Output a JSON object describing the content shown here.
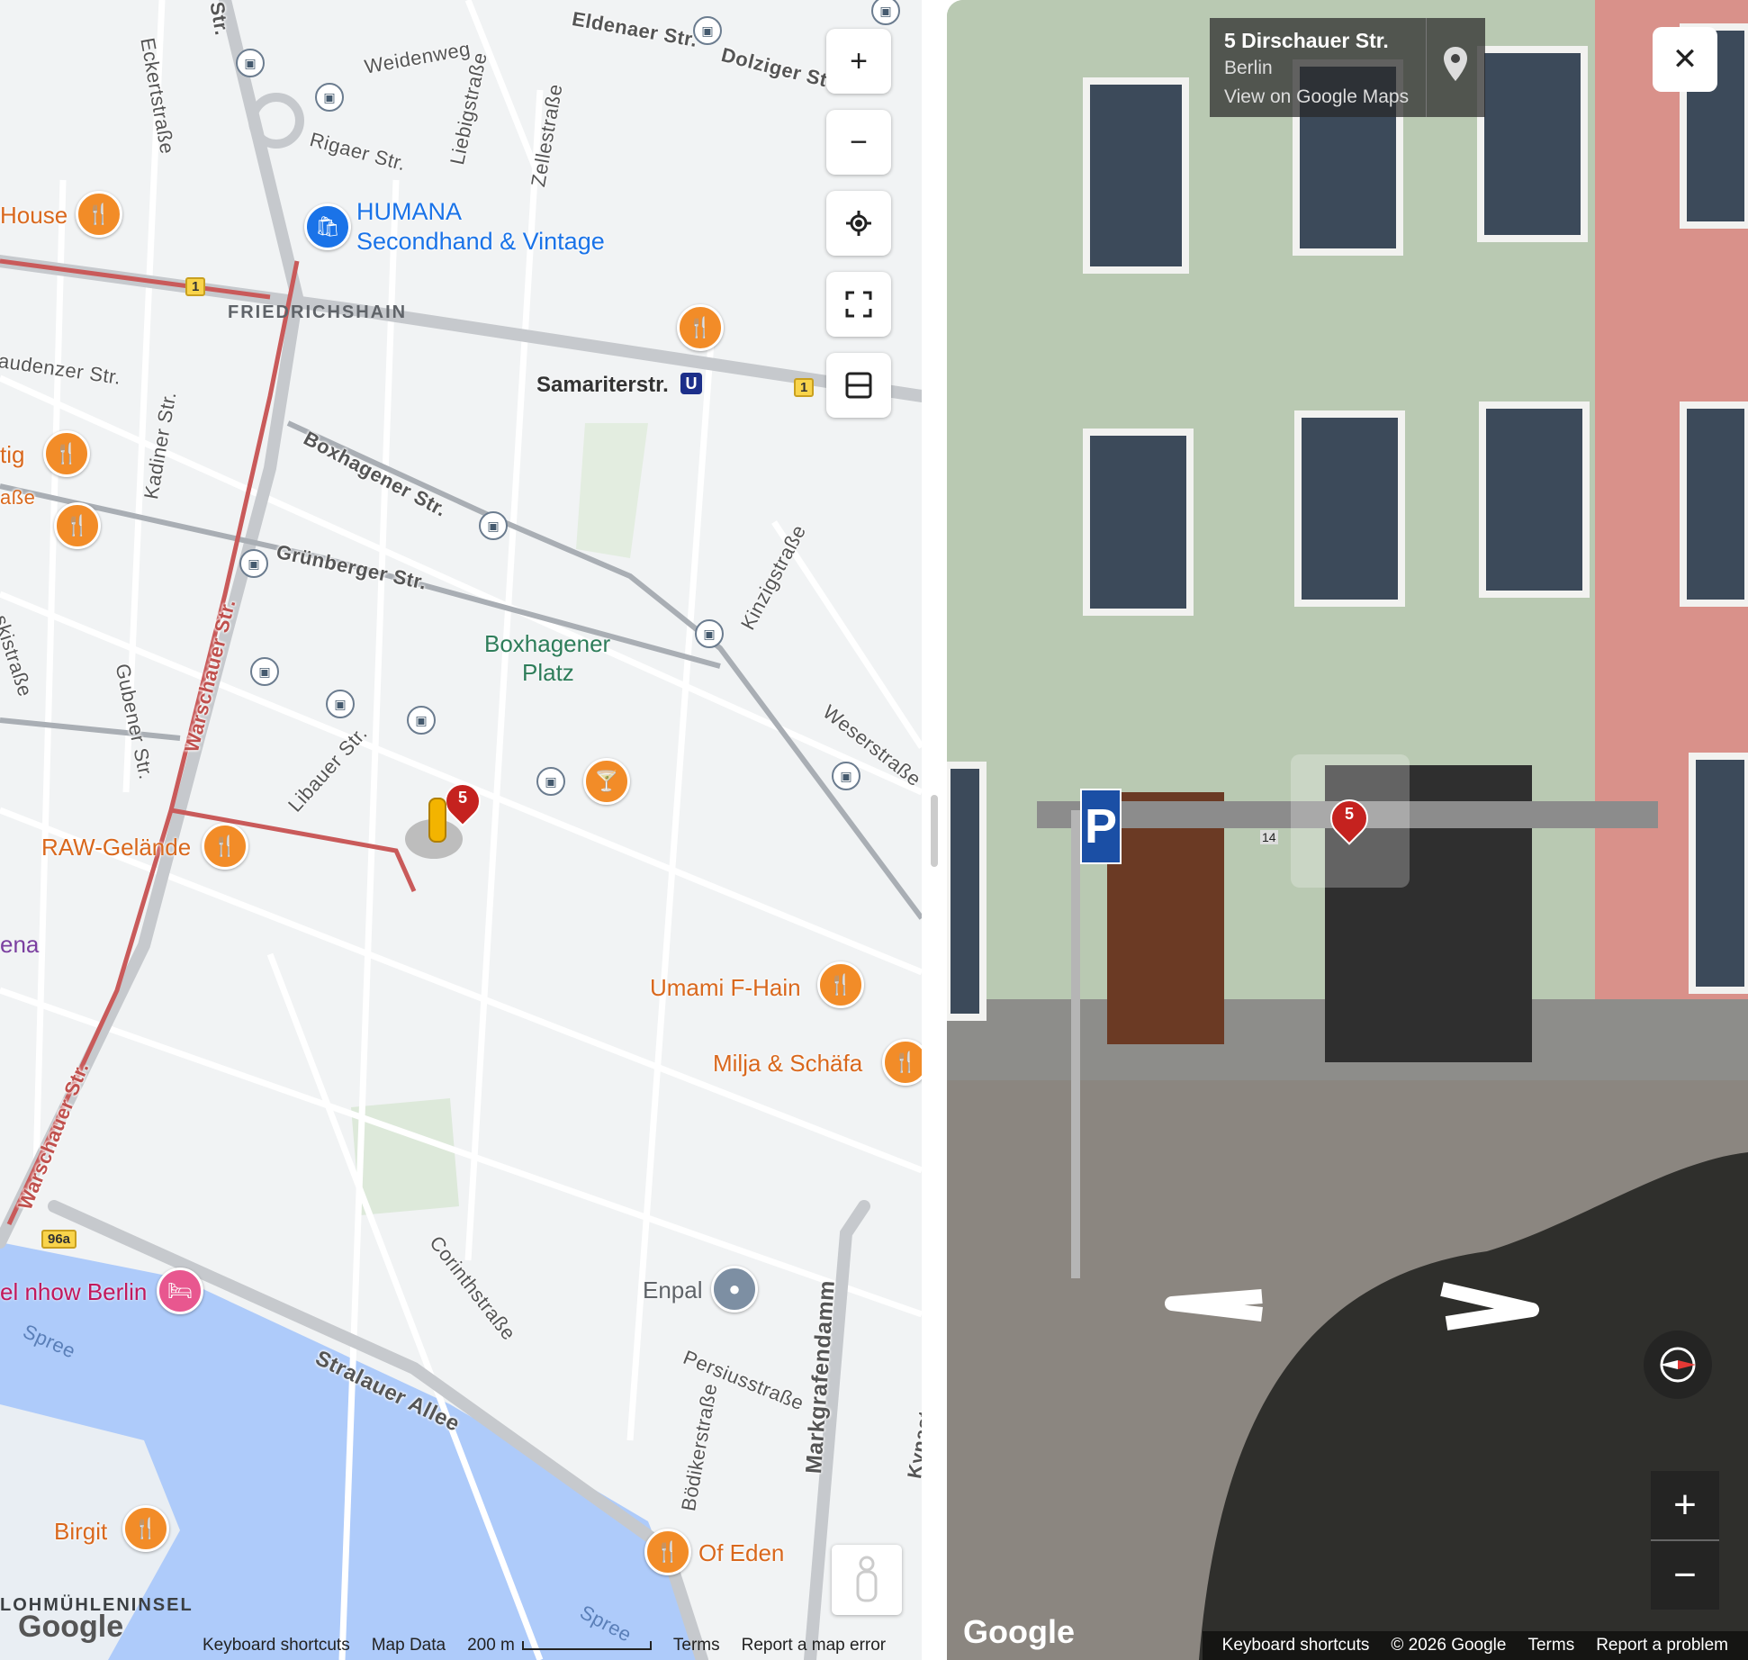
{
  "map": {
    "streets": {
      "eldenaer": "Eldenaer Str.",
      "dolziger": "Dolziger Str.",
      "weidenweg": "Weidenweg",
      "eckert": "Eckertstraße",
      "str_top": "Str.",
      "liebig": "Liebigstraße",
      "zelle": "Zellestraße",
      "rigaer": "Rigaer Str.",
      "audenzer": "audenzer Str.",
      "kadiner": "Kadiner Str.",
      "boxhagener": "Boxhagener Str.",
      "gruenberger": "Grünberger Str.",
      "kinzig": "Kinzigstraße",
      "weser": "Weserstraße",
      "kiski": "skistraße",
      "gubener": "Gubener Str.",
      "warschauer1": "Warschauer Str.",
      "warschauer2": "Warschauer Str.",
      "libauer": "Libauer Str.",
      "corinth": "Corinthstraße",
      "persius": "Persiusstraße",
      "boediker": "Bödikerstraße",
      "markgrafen": "Markgrafendamm",
      "kynast": "Kynast",
      "stralauer": "Stralauer Allee",
      "spree1": "Spree",
      "spree2": "Spree",
      "abe": "aße"
    },
    "places": {
      "house": "House",
      "humana_line1": "HUMANA",
      "humana_line2": "Secondhand & Vintage",
      "friedrichshain": "FRIEDRICHSHAIN",
      "samariterstr": "Samariterstr.",
      "u_badge": "U",
      "tig": "tig",
      "boxhagener_platz_1": "Boxhagener",
      "boxhagener_platz_2": "Platz",
      "raw": "RAW-Gelände",
      "ena": "ena",
      "umami": "Umami F-Hain",
      "milja": "Milja & Schäfa",
      "enpal": "Enpal",
      "nhow": "el nhow Berlin",
      "birgit": "Birgit",
      "of_eden": "Of Eden",
      "lohmuehleninsel": "LOHMÜHLENINSEL"
    },
    "shields": {
      "s1a": "1",
      "s1b": "1",
      "s96a": "96a"
    },
    "marker_number": "5",
    "logo": "Google",
    "footer": {
      "keyboard": "Keyboard shortcuts",
      "mapdata": "Map Data",
      "scale": "200 m",
      "terms": "Terms",
      "report": "Report a map error"
    },
    "controls": {
      "zoom_in": "+",
      "zoom_out": "−"
    }
  },
  "streetview": {
    "address": "5 Dirschauer Str.",
    "city": "Berlin",
    "view_link": "View on Google Maps",
    "close": "✕",
    "marker_number": "5",
    "house_number": "14",
    "parking_sign": "P",
    "logo": "Google",
    "footer": {
      "keyboard": "Keyboard shortcuts",
      "copyright": "© 2026 Google",
      "terms": "Terms",
      "report": "Report a problem"
    },
    "zoom_in": "+",
    "zoom_out": "−"
  },
  "colors": {
    "poi_orange": "#f28c28",
    "route_red": "#c95a5a",
    "water": "#aecbfa",
    "park": "#cfe8d2",
    "accent_blue": "#1a73e8"
  }
}
